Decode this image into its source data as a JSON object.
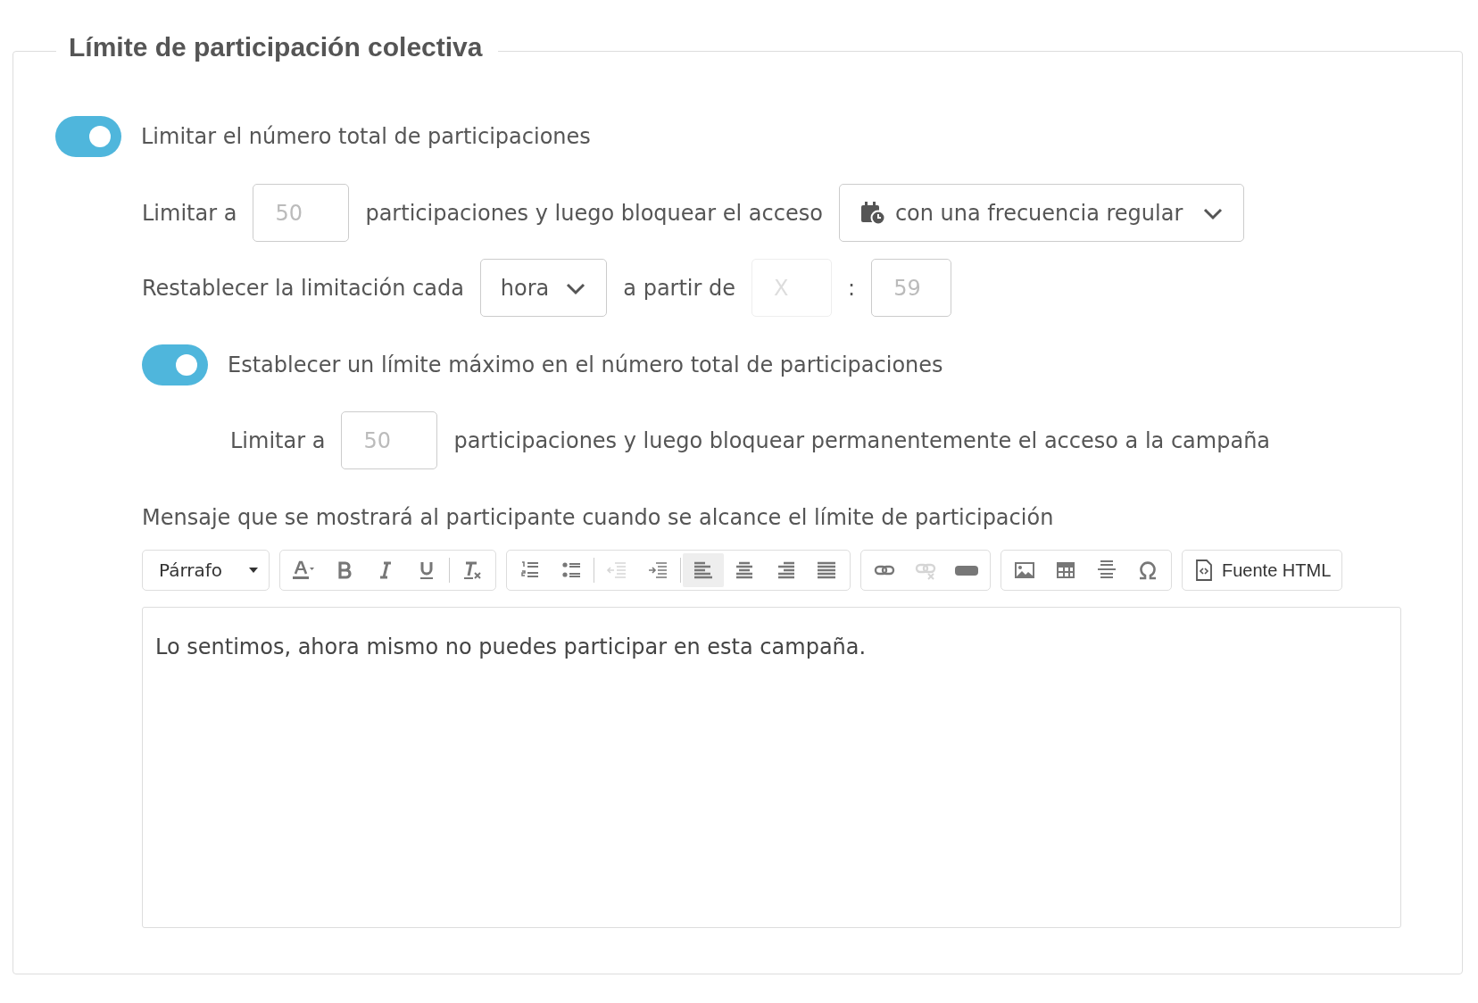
{
  "legend": "Límite de participación colectiva",
  "limit_toggle": {
    "label": "Limitar el número total de participaciones",
    "on": true
  },
  "limit_row": {
    "prefix": "Limitar a",
    "input": {
      "placeholder": "50"
    },
    "middle": "participaciones y luego bloquear el acceso",
    "select": {
      "value": "con una frecuencia regular"
    }
  },
  "reset_row": {
    "prefix": "Restablecer la limitación cada",
    "unit": {
      "value": "hora"
    },
    "from_label": "a partir de",
    "hour": {
      "placeholder": "X",
      "disabled": true
    },
    "separator": ":",
    "minute": {
      "placeholder": "59",
      "disabled": false
    }
  },
  "max_toggle": {
    "label": "Establecer un límite máximo en el número total de participaciones",
    "on": true
  },
  "max_row": {
    "prefix": "Limitar a",
    "input": {
      "placeholder": "50"
    },
    "suffix": "participaciones y luego bloquear permanentemente el acceso a la campaña"
  },
  "message": {
    "label": "Mensaje que se mostrará al participante cuando se alcance el límite de participación",
    "format": "Párrafo",
    "toolbar": [
      {
        "items": [
          {
            "kind": "text-color",
            "disabled": false,
            "selected": false
          },
          {
            "kind": "bold",
            "disabled": false,
            "selected": false
          },
          {
            "kind": "italic",
            "disabled": false,
            "selected": false
          },
          {
            "kind": "underline",
            "disabled": false,
            "selected": false
          },
          {
            "kind": "clear-format",
            "disabled": false,
            "selected": false
          }
        ]
      },
      {
        "items": [
          {
            "kind": "ordered-list",
            "disabled": false,
            "selected": false
          },
          {
            "kind": "bullet-list",
            "disabled": false,
            "selected": false
          },
          {
            "kind": "outdent",
            "disabled": true,
            "selected": false
          },
          {
            "kind": "indent",
            "disabled": false,
            "selected": false
          },
          {
            "kind": "align-left",
            "disabled": false,
            "selected": true
          },
          {
            "kind": "align-center",
            "disabled": false,
            "selected": false
          },
          {
            "kind": "align-right",
            "disabled": false,
            "selected": false
          },
          {
            "kind": "justify",
            "disabled": false,
            "selected": false
          }
        ]
      },
      {
        "items": [
          {
            "kind": "link",
            "disabled": false,
            "selected": false
          },
          {
            "kind": "unlink",
            "disabled": true,
            "selected": false
          },
          {
            "kind": "button",
            "disabled": false,
            "selected": false
          }
        ]
      },
      {
        "items": [
          {
            "kind": "image",
            "disabled": false,
            "selected": false
          },
          {
            "kind": "table",
            "disabled": false,
            "selected": false
          },
          {
            "kind": "horizontal-rule",
            "disabled": false,
            "selected": false
          },
          {
            "kind": "special-character",
            "disabled": false,
            "selected": false
          }
        ]
      }
    ],
    "source_button": "Fuente HTML",
    "content": "Lo sentimos, ahora mismo no puedes participar en esta campaña."
  }
}
